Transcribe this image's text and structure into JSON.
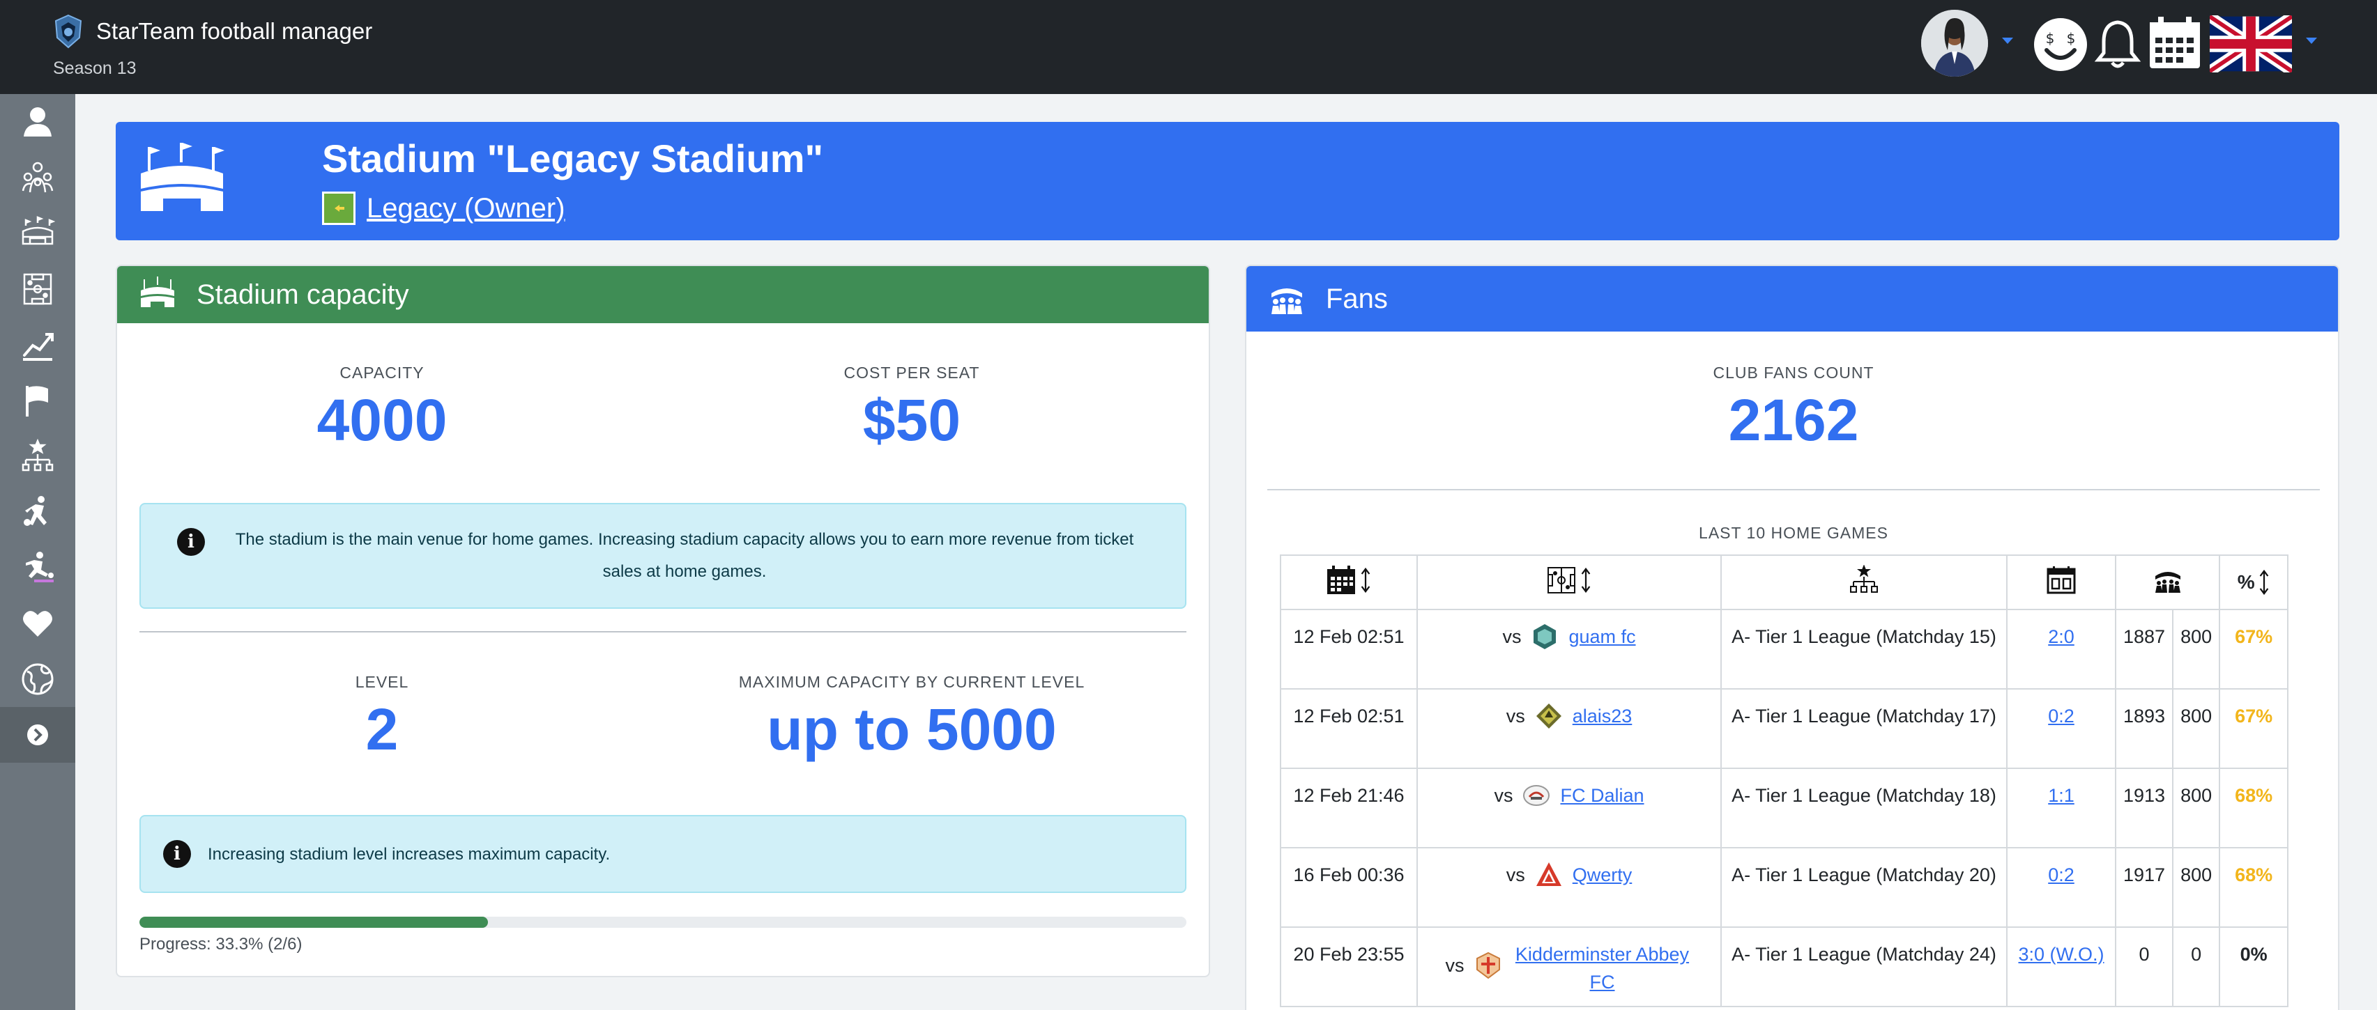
{
  "app": {
    "title": "StarTeam football manager",
    "season": "Season 13"
  },
  "banner": {
    "title": "Stadium \"Legacy Stadium\"",
    "owner_link": "Legacy (Owner)"
  },
  "capacity_card": {
    "title": "Stadium capacity",
    "capacity_label": "CAPACITY",
    "capacity_value": "4000",
    "cost_label": "COST PER SEAT",
    "cost_value": "$50",
    "info1": "The stadium is the main venue for home games. Increasing stadium capacity allows you to earn more revenue from ticket sales at home games.",
    "level_label": "LEVEL",
    "level_value": "2",
    "max_label": "MAXIMUM CAPACITY BY CURRENT LEVEL",
    "max_value": "up to 5000",
    "info2": "Increasing stadium level increases maximum capacity.",
    "progress_text": "Progress: 33.3% (2/6)",
    "progress_fraction": 0.333
  },
  "fans_card": {
    "title": "Fans",
    "fans_label": "CLUB FANS COUNT",
    "fans_value": "2162",
    "games_caption": "LAST 10 HOME GAMES",
    "percent_header": "%",
    "rows": [
      {
        "date": "12 Feb 02:51",
        "vs": "vs",
        "team": "guam fc",
        "competition": "A- Tier 1 League (Matchday 15)",
        "score": "2:0",
        "attendance": "1887",
        "capacity": "800",
        "percent": "67%"
      },
      {
        "date": "12 Feb 02:51",
        "vs": "vs",
        "team": "alais23",
        "competition": "A- Tier 1 League (Matchday 17)",
        "score": "0:2",
        "attendance": "1893",
        "capacity": "800",
        "percent": "67%"
      },
      {
        "date": "12 Feb 21:46",
        "vs": "vs",
        "team": "FC Dalian",
        "competition": "A- Tier 1 League (Matchday 18)",
        "score": "1:1",
        "attendance": "1913",
        "capacity": "800",
        "percent": "68%"
      },
      {
        "date": "16 Feb 00:36",
        "vs": "vs",
        "team": "Qwerty",
        "competition": "A- Tier 1 League (Matchday 20)",
        "score": "0:2",
        "attendance": "1917",
        "capacity": "800",
        "percent": "68%"
      },
      {
        "date": "20 Feb 23:55",
        "vs": "vs",
        "team": "Kidderminster Abbey FC",
        "competition": "A- Tier 1 League (Matchday 24)",
        "score": "3:0 (W.O.)",
        "attendance": "0",
        "capacity": "0",
        "percent": "0%"
      }
    ]
  },
  "colors": {
    "primary": "#316ff0",
    "success": "#3f8d55",
    "warning": "#f2b51b",
    "dark": "#212529",
    "sidebar": "#6c757d"
  },
  "icons": {
    "sidebar": [
      "user-icon",
      "team-icon",
      "stadium-icon",
      "tactics-icon",
      "chart-icon",
      "flag-icon",
      "hierarchy-icon",
      "player-run-icon",
      "training-icon",
      "heart-icon",
      "globe-icon",
      "chevron-right-icon"
    ],
    "topbar": [
      "avatar",
      "money-face-icon",
      "bell-icon",
      "calendar-icon",
      "uk-flag-icon"
    ]
  }
}
